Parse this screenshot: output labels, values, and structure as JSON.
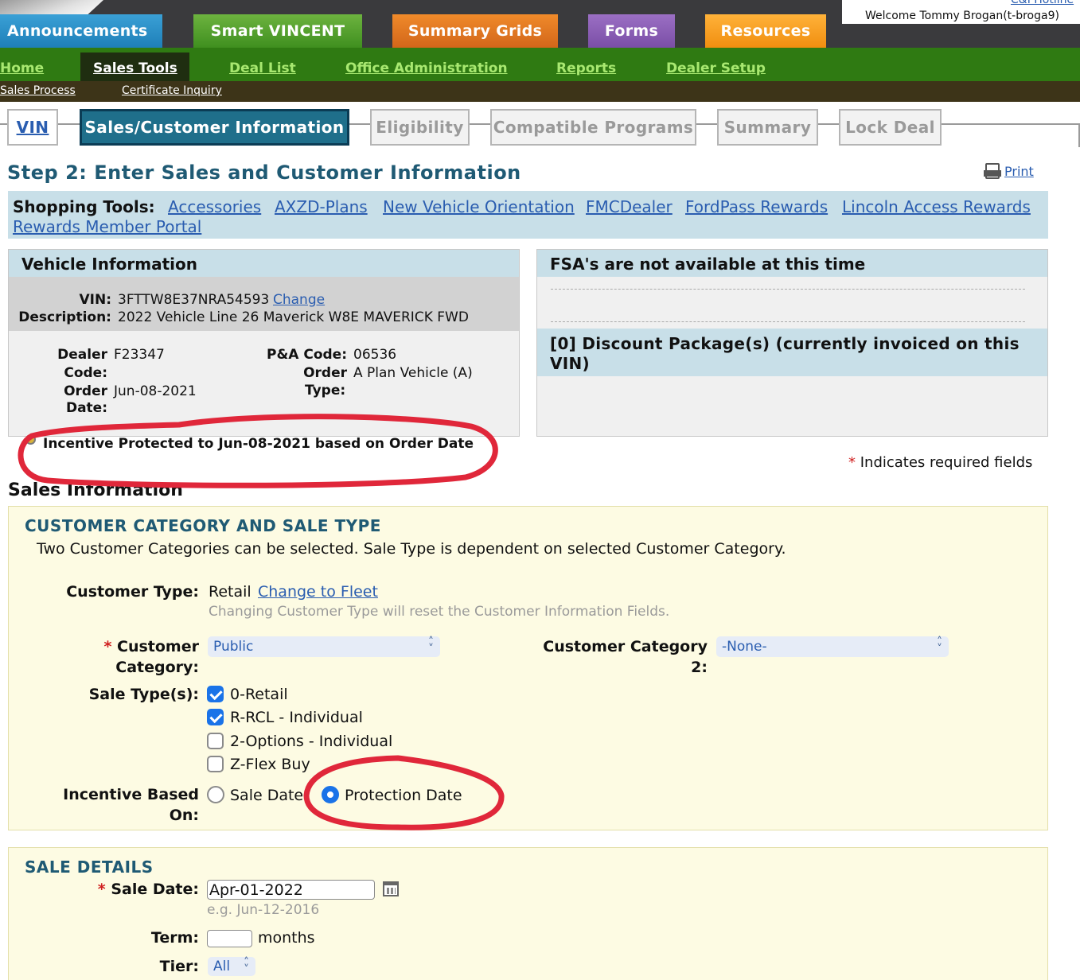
{
  "header": {
    "hotline": "C&I Hotline",
    "welcome": "Welcome Tommy Brogan(t-broga9)",
    "main_tabs": [
      "Announcements",
      "Smart VINCENT",
      "Summary Grids",
      "Forms",
      "Resources"
    ],
    "nav": [
      "Home",
      "Sales Tools",
      "Deal List",
      "Office Administration",
      "Reports",
      "Dealer Setup"
    ],
    "subnav": [
      "Sales Process",
      "Certificate Inquiry"
    ]
  },
  "steps": [
    "VIN",
    "Sales/Customer Information",
    "Eligibility",
    "Compatible Programs",
    "Summary",
    "Lock Deal"
  ],
  "page": {
    "title": "Step 2: Enter Sales and Customer Information",
    "print": "Print"
  },
  "shopping": {
    "label": "Shopping Tools:",
    "links": [
      "Accessories",
      "AXZD-Plans",
      "New Vehicle Orientation",
      "FMCDealer",
      "FordPass Rewards",
      "Lincoln Access Rewards",
      "Rewards Member Portal"
    ]
  },
  "vehicle": {
    "title": "Vehicle Information",
    "vin_label": "VIN:",
    "vin": "3FTTW8E37NRA54593",
    "change": "Change",
    "desc_label": "Description:",
    "description": "2022 Vehicle Line 26 Maverick W8E MAVERICK FWD",
    "dealer_code_label_1": "Dealer",
    "dealer_code_label_2": "Code:",
    "dealer_code": "F23347",
    "order_date_label_1": "Order",
    "order_date_label_2": "Date:",
    "order_date": "Jun-08-2021",
    "pa_code_label": "P&A Code:",
    "pa_code": "06536",
    "order_type_label_1": "Order",
    "order_type_label_2": "Type:",
    "order_type": "A Plan Vehicle (A)",
    "protected_note": "Incentive Protected to Jun-08-2021 based on Order Date"
  },
  "fsa": {
    "title": "FSA's are not available at this time",
    "discount_title": "[0] Discount Package(s) (currently invoiced on this VIN)"
  },
  "required_note": "Indicates required fields",
  "sales_info": {
    "heading": "Sales Information",
    "category_title": "CUSTOMER CATEGORY AND SALE TYPE",
    "category_desc": "Two Customer Categories can be selected. Sale Type is dependent on selected Customer Category.",
    "customer_type_label": "Customer Type:",
    "customer_type": "Retail",
    "change_to_fleet": "Change to Fleet",
    "customer_type_hint": "Changing Customer Type will reset the Customer Information Fields.",
    "category_label_1": "Customer",
    "category_label_2": "Category:",
    "category_value": "Public",
    "category2_label_1": "Customer Category",
    "category2_label_2": "2:",
    "category2_value": "-None-",
    "sale_types_label": "Sale Type(s):",
    "sale_types": [
      {
        "label": "0-Retail",
        "checked": true
      },
      {
        "label": "R-RCL - Individual",
        "checked": true
      },
      {
        "label": "2-Options - Individual",
        "checked": false
      },
      {
        "label": "Z-Flex Buy",
        "checked": false
      }
    ],
    "incentive_label_1": "Incentive Based",
    "incentive_label_2": "On:",
    "incentive_options": [
      "Sale Date",
      "Protection Date"
    ],
    "incentive_selected": "Protection Date"
  },
  "sale_details": {
    "title": "SALE DETAILS",
    "sale_date_label": "Sale Date:",
    "sale_date": "Apr-01-2022",
    "sale_date_hint": "e.g. Jun-12-2016",
    "term_label": "Term:",
    "term_value": "",
    "term_unit": "months",
    "tier_label": "Tier:",
    "tier_value": "All"
  },
  "colors": {
    "step_active": "#1f6f8b",
    "nav_green": "#2f7a12",
    "panel_blue": "#c8dfe8",
    "yellow_bg": "#fdfbe3",
    "annotation_red": "#e0273a"
  }
}
